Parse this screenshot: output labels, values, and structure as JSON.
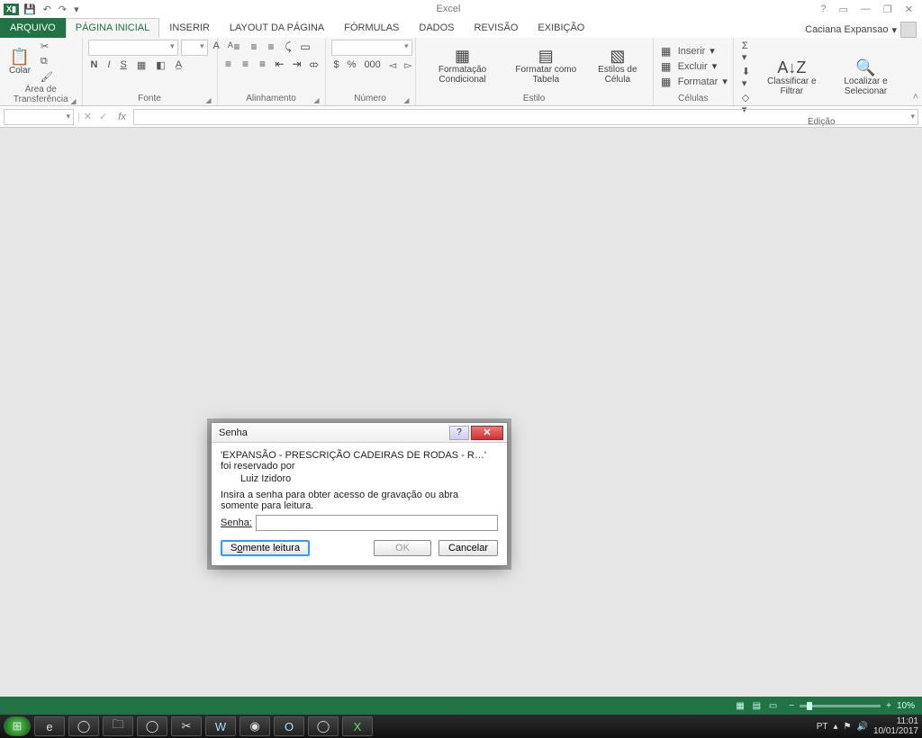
{
  "titlebar": {
    "app": "Excel"
  },
  "qat": {
    "save": "💾",
    "undo": "↶",
    "redo": "↷"
  },
  "winbtns": {
    "help": "?",
    "ribbonopts": "▭",
    "min": "—",
    "restore": "❐",
    "close": "✕"
  },
  "tabs": {
    "file": "ARQUIVO",
    "home": "PÁGINA INICIAL",
    "insert": "INSERIR",
    "layout": "LAYOUT DA PÁGINA",
    "formulas": "FÓRMULAS",
    "data": "DADOS",
    "review": "REVISÃO",
    "view": "EXIBIÇÃO",
    "user": "Caciana Expansao"
  },
  "ribbon": {
    "clipboard": {
      "paste": "Colar",
      "label": "Área de Transferência"
    },
    "font": {
      "bold": "N",
      "italic": "I",
      "underline": "S",
      "label": "Fonte",
      "incA": "A",
      "decA": "A"
    },
    "align": {
      "label": "Alinhamento",
      "wrap": "▭",
      "merge": "⤄"
    },
    "number": {
      "label": "Número",
      "pct": "%",
      "comma": "000",
      "inc": "◅",
      "dec": "▻"
    },
    "styles": {
      "cond": "Formatação Condicional",
      "table": "Formatar como Tabela",
      "cell": "Estilos de Célula",
      "label": "Estilo"
    },
    "cells": {
      "insert": "Inserir",
      "delete": "Excluir",
      "format": "Formatar",
      "label": "Células"
    },
    "editing": {
      "sort": "Classificar e Filtrar",
      "find": "Localizar e Selecionar",
      "label": "Edição"
    }
  },
  "fbar": {
    "cancel": "✕",
    "enter": "✓",
    "fx": "fx"
  },
  "dialog": {
    "title": "Senha",
    "line1": "'EXPANSÃO  -  PRESCRIÇÃO CADEIRAS DE RODAS  -  R…' foi reservado por",
    "line1b": "Luiz Izidoro",
    "line2": "Insira a senha para obter acesso de gravação ou abra somente para leitura.",
    "pw_label_pre": "S",
    "pw_label_u": "e",
    "pw_label_post": "nha:",
    "readonly_pre": "S",
    "readonly_u": "o",
    "readonly_post": "mente leitura",
    "ok": "OK",
    "cancel": "Cancelar"
  },
  "status": {
    "zoom": "10%"
  },
  "taskbar": {
    "lang": "PT",
    "time": "11:01",
    "date": "10/01/2017"
  }
}
